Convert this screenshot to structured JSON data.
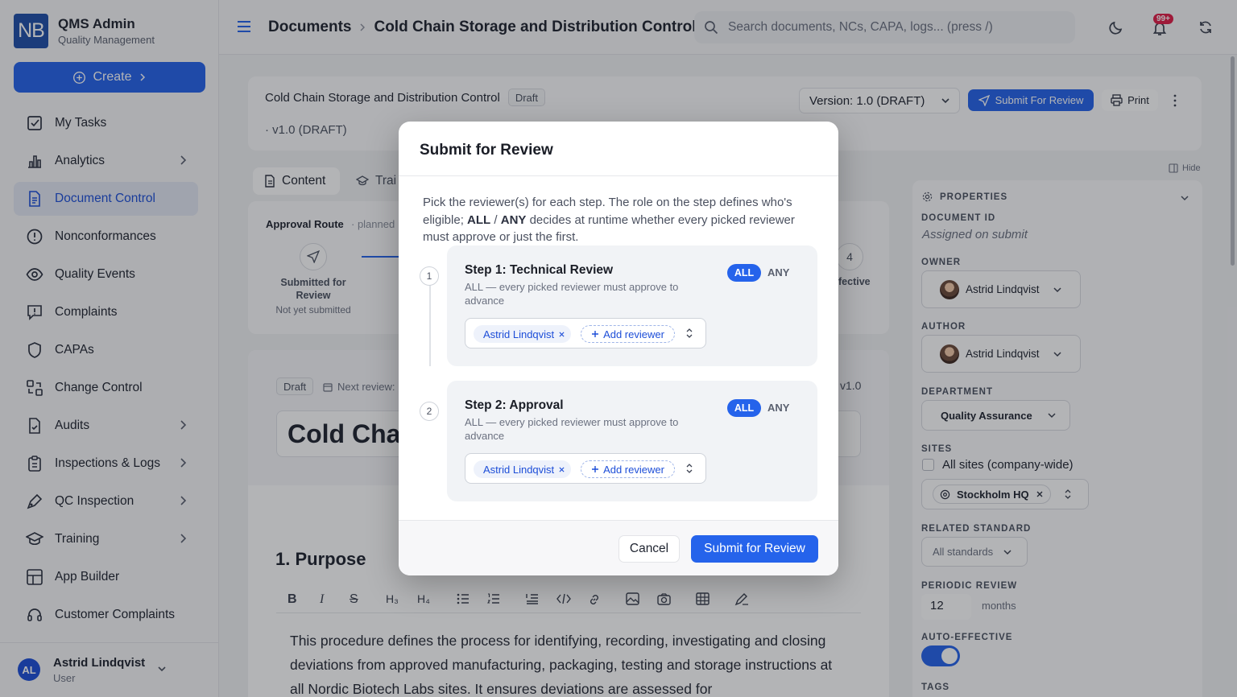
{
  "app": {
    "logo": "NB",
    "title": "QMS Admin",
    "subtitle": "Quality Management",
    "create_label": "Create"
  },
  "sidebar": {
    "items": [
      {
        "label": "My Tasks"
      },
      {
        "label": "Analytics"
      },
      {
        "label": "Document Control"
      },
      {
        "label": "Nonconformances"
      },
      {
        "label": "Quality Events"
      },
      {
        "label": "Complaints"
      },
      {
        "label": "CAPAs"
      },
      {
        "label": "Change Control"
      },
      {
        "label": "Audits"
      },
      {
        "label": "Inspections & Logs"
      },
      {
        "label": "QC Inspection"
      },
      {
        "label": "Training"
      },
      {
        "label": "App Builder"
      },
      {
        "label": "Customer Complaints"
      }
    ],
    "user": {
      "initials": "AL",
      "name": "Astrid Lindqvist",
      "role": "User"
    }
  },
  "header": {
    "breadcrumb_root": "Documents",
    "breadcrumb_current": "Cold Chain Storage and Distribution Control",
    "search_placeholder": "Search documents, NCs, CAPA, logs...  (press /)",
    "notification_count": "99+"
  },
  "doc": {
    "title": "Cold Chain Storage and Distribution Control",
    "status": "Draft",
    "version_line": "· v1.0 (DRAFT)",
    "version_select": "Version: 1.0 (DRAFT)",
    "submit_label": "Submit For Review",
    "print_label": "Print",
    "tabs": [
      "Content",
      "Trai"
    ],
    "approval_route_label": "Approval Route",
    "approval_route_status": "· planned",
    "route_step1_label": "Submitted for Review",
    "route_step1_status": "Not yet submitted",
    "route_step4_num": "4",
    "route_step4_label": "fective",
    "editor_status": "Draft",
    "next_review": "Next review:",
    "version_tag": "v1.0",
    "editor_title": "Cold Cha",
    "section_heading": "1.  Purpose",
    "body_text": "This procedure defines the process for identifying, recording, investigating and closing deviations from approved manufacturing, packaging, testing and storage instructions at all Nordic Biotech Labs sites. It ensures deviations are assessed for"
  },
  "properties": {
    "hide_label": "Hide",
    "section_label": "PROPERTIES",
    "document_id_label": "DOCUMENT ID",
    "document_id_value": "Assigned on submit",
    "owner_label": "OWNER",
    "owner_value": "Astrid Lindqvist",
    "author_label": "AUTHOR",
    "author_value": "Astrid Lindqvist",
    "department_label": "DEPARTMENT",
    "department_value": "Quality Assurance",
    "sites_label": "SITES",
    "sites_checkbox": "All sites (company-wide)",
    "site_value": "Stockholm HQ",
    "related_standard_label": "RELATED STANDARD",
    "related_standard_value": "All standards",
    "periodic_review_label": "PERIODIC REVIEW",
    "periodic_review_value": "12",
    "periodic_review_unit": "months",
    "auto_effective_label": "AUTO-EFFECTIVE",
    "auto_effective_on": true,
    "tags_label": "TAGS"
  },
  "modal": {
    "title": "Submit for Review",
    "description_pre": "Pick the reviewer(s) for each step. The role on the step defines who's eligible; ",
    "description_all": "ALL",
    "description_sep": " / ",
    "description_any": "ANY",
    "description_post": " decides at runtime whether every picked reviewer must approve or just the first.",
    "steps": [
      {
        "num": "1",
        "title": "Step 1: Technical Review",
        "mode_all": "ALL",
        "mode_any": "ANY",
        "hint": "ALL — every picked reviewer must approve to advance",
        "reviewer": "Astrid Lindqvist",
        "add_label": "Add reviewer"
      },
      {
        "num": "2",
        "title": "Step 2: Approval",
        "mode_all": "ALL",
        "mode_any": "ANY",
        "hint": "ALL — every picked reviewer must approve to advance",
        "reviewer": "Astrid Lindqvist",
        "add_label": "Add reviewer"
      }
    ],
    "cancel_label": "Cancel",
    "submit_label": "Submit for Review"
  },
  "colors": {
    "accent": "#2563eb",
    "badge": "#e11d48"
  }
}
